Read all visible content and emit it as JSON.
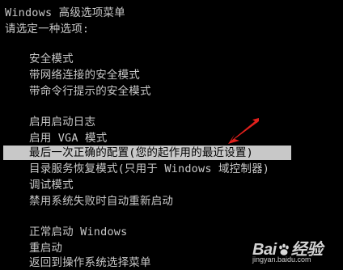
{
  "screen": {
    "title": "Windows 高级选项菜单",
    "prompt": "请选定一种选项:"
  },
  "groups": {
    "safe": [
      "安全模式",
      "带网络连接的安全模式",
      "带命令行提示的安全模式"
    ],
    "startup": [
      "启用启动日志",
      "启用 VGA 模式",
      "最后一次正确的配置(您的起作用的最近设置)",
      "目录服务恢复模式(只用于 Windows 域控制器)",
      "调试模式",
      "禁用系统失败时自动重新启动"
    ],
    "normal": [
      "正常启动 Windows",
      "重启动",
      "返回到操作系统选择菜单"
    ]
  },
  "selected_item": "最后一次正确的配置(您的起作用的最近设置)",
  "annotation": {
    "icon": "red-arrow-icon",
    "color": "#e0201c"
  },
  "watermark": {
    "logo_text_a": "Bai",
    "logo_text_b": "经验",
    "url": "jingyan.baidu.com"
  },
  "colors": {
    "background": "#000000",
    "text": "#c8c8c8",
    "highlight_bg": "#c8c8c8",
    "highlight_text": "#000000"
  }
}
